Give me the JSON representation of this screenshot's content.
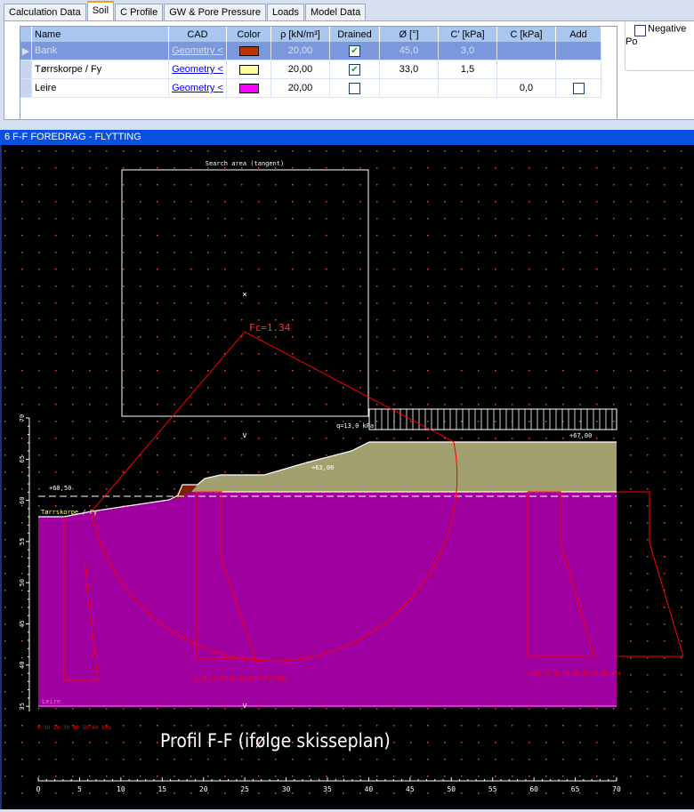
{
  "tabs": [
    {
      "label": "Calculation Data"
    },
    {
      "label": "Soil"
    },
    {
      "label": "C Profile"
    },
    {
      "label": "GW & Pore Pressure"
    },
    {
      "label": "Loads"
    },
    {
      "label": "Model Data"
    }
  ],
  "active_tab": "Soil",
  "soil_table": {
    "headers": [
      "Name",
      "CAD",
      "Color",
      "ρ [kN/m³]",
      "Drained",
      "Ø [°]",
      "C' [kPa]",
      "C [kPa]",
      "Add"
    ],
    "rows": [
      {
        "name": "Bank",
        "cad": "Geometry <",
        "color": "#c03000",
        "rho": "20,00",
        "drained": true,
        "phi": "45,0",
        "c_eff": "3,0",
        "c": "",
        "add": null,
        "selected": true
      },
      {
        "name": "Tørrskorpe / Fy",
        "cad": "Geometry <",
        "color": "#ffffa0",
        "rho": "20,00",
        "drained": true,
        "phi": "33,0",
        "c_eff": "1,5",
        "c": "",
        "add": null,
        "selected": false
      },
      {
        "name": "Leire",
        "cad": "Geometry <",
        "color": "#ff00ff",
        "rho": "20,00",
        "drained": false,
        "phi": "",
        "c_eff": "",
        "c": "0,0",
        "add": false,
        "selected": false
      }
    ]
  },
  "side_option": {
    "label": "Negative Po",
    "checked": false
  },
  "window_title": "6 F-F FOREDRAG - FLYTTING",
  "cad": {
    "search_area_label": "Search area (tangent)",
    "safety_factor": "Fc=1.34",
    "load_label": "q=13,0 kPa",
    "levels": [
      "+60,50",
      "+63,00",
      "+67,00"
    ],
    "layer_labels": {
      "crust": "Tørrskorpe / Fy",
      "clay": "Leire"
    },
    "drawing_title": "Profil F-F (ifølge skisseplan)",
    "x_axis": {
      "min": 0,
      "max": 70,
      "step": 5,
      "labels": [
        "0",
        "5",
        "10",
        "15",
        "20",
        "25",
        "30",
        "35",
        "40",
        "45",
        "50",
        "55",
        "60",
        "65",
        "70"
      ]
    },
    "y_axis": {
      "labels": [
        "70",
        "65",
        "60",
        "55",
        "50",
        "45",
        "40",
        "35"
      ]
    },
    "scale_labels": [
      "0 10 20 30 40 50 60 70 80 kPa",
      "0 10 20 30 40 50 60 70 80 kPa",
      "0 10 20 30 40 50 60 kPa"
    ],
    "colors": {
      "clay": "#a000a0",
      "crust": "#a3a070",
      "bank": "#802000",
      "slip": "#ff0000"
    }
  }
}
